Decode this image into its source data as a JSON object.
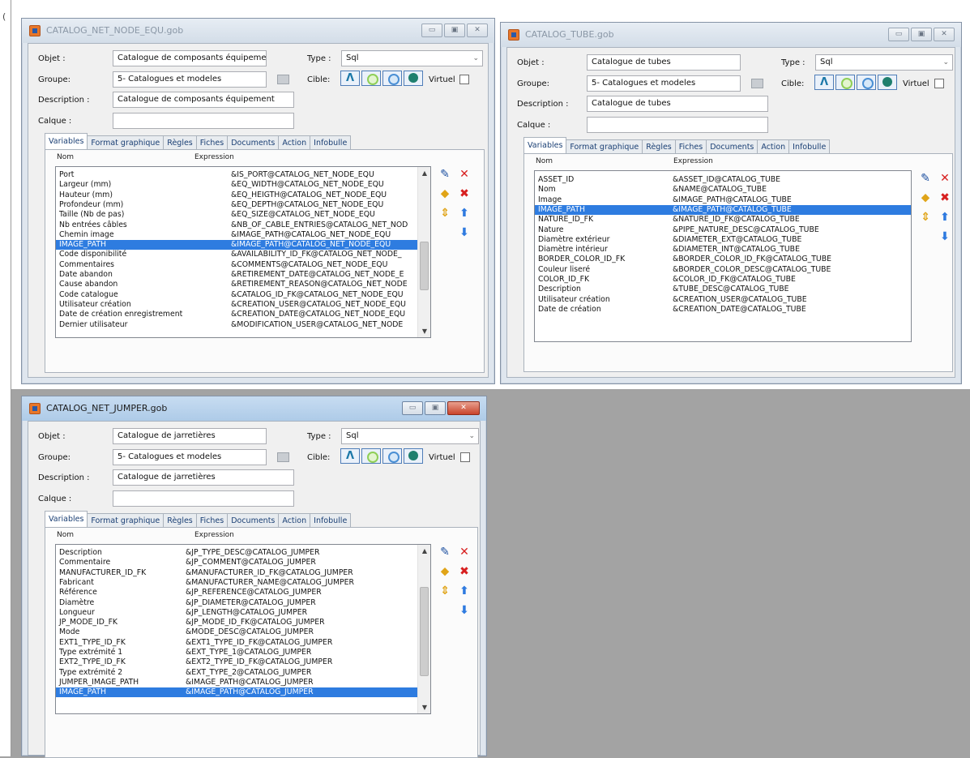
{
  "labels": {
    "objet": "Objet :",
    "groupe": "Groupe:",
    "description": "Description :",
    "calque": "Calque :",
    "type": "Type :",
    "cible": "Cible:",
    "virtuel": "Virtuel",
    "col_nom": "Nom",
    "col_expression": "Expression"
  },
  "tabs": [
    "Variables",
    "Format graphique",
    "Règles",
    "Fiches",
    "Documents",
    "Action",
    "Infobulle"
  ],
  "windows": {
    "equ": {
      "title": "CATALOG_NET_NODE_EQU.gob",
      "objet": "Catalogue de composants équipement",
      "type": "Sql",
      "groupe": "5- Catalogues et modeles",
      "description": "Catalogue de composants équipement",
      "calque": "",
      "variables": [
        {
          "nom": "Port",
          "expression": "&IS_PORT@CATALOG_NET_NODE_EQU"
        },
        {
          "nom": "Largeur (mm)",
          "expression": "&EQ_WIDTH@CATALOG_NET_NODE_EQU"
        },
        {
          "nom": "Hauteur (mm)",
          "expression": "&EQ_HEIGTH@CATALOG_NET_NODE_EQU"
        },
        {
          "nom": "Profondeur (mm)",
          "expression": "&EQ_DEPTH@CATALOG_NET_NODE_EQU"
        },
        {
          "nom": "Taille (Nb de pas)",
          "expression": "&EQ_SIZE@CATALOG_NET_NODE_EQU"
        },
        {
          "nom": "Nb entrées câbles",
          "expression": "&NB_OF_CABLE_ENTRIES@CATALOG_NET_NOD"
        },
        {
          "nom": "Chemin image",
          "expression": "&IMAGE_PATH@CATALOG_NET_NODE_EQU"
        },
        {
          "nom": "IMAGE_PATH",
          "expression": "&IMAGE_PATH@CATALOG_NET_NODE_EQU",
          "selected": true
        },
        {
          "nom": "Code disponibilité",
          "expression": "&AVAILABILITY_ID_FK@CATALOG_NET_NODE_"
        },
        {
          "nom": "Commentaires",
          "expression": "&COMMENTS@CATALOG_NET_NODE_EQU"
        },
        {
          "nom": "Date abandon",
          "expression": "&RETIREMENT_DATE@CATALOG_NET_NODE_E"
        },
        {
          "nom": "Cause abandon",
          "expression": "&RETIREMENT_REASON@CATALOG_NET_NODE"
        },
        {
          "nom": "Code catalogue",
          "expression": "&CATALOG_ID_FK@CATALOG_NET_NODE_EQU"
        },
        {
          "nom": "Utilisateur création",
          "expression": "&CREATION_USER@CATALOG_NET_NODE_EQU"
        },
        {
          "nom": "Date de création enregistrement",
          "expression": "&CREATION_DATE@CATALOG_NET_NODE_EQU"
        },
        {
          "nom": "Dernier utilisateur",
          "expression": "&MODIFICATION_USER@CATALOG_NET_NODE"
        }
      ]
    },
    "tube": {
      "title": "CATALOG_TUBE.gob",
      "objet": "Catalogue de tubes",
      "type": "Sql",
      "groupe": "5- Catalogues et modeles",
      "description": "Catalogue de tubes",
      "calque": "",
      "variables": [
        {
          "nom": "ASSET_ID",
          "expression": "&ASSET_ID@CATALOG_TUBE"
        },
        {
          "nom": "Nom",
          "expression": "&NAME@CATALOG_TUBE"
        },
        {
          "nom": "Image",
          "expression": "&IMAGE_PATH@CATALOG_TUBE"
        },
        {
          "nom": "IMAGE_PATH",
          "expression": "&IMAGE_PATH@CATALOG_TUBE",
          "selected": true
        },
        {
          "nom": "NATURE_ID_FK",
          "expression": "&NATURE_ID_FK@CATALOG_TUBE"
        },
        {
          "nom": "Nature",
          "expression": "&PIPE_NATURE_DESC@CATALOG_TUBE"
        },
        {
          "nom": "Diamètre extérieur",
          "expression": "&DIAMETER_EXT@CATALOG_TUBE"
        },
        {
          "nom": "Diamètre intérieur",
          "expression": "&DIAMETER_INT@CATALOG_TUBE"
        },
        {
          "nom": "BORDER_COLOR_ID_FK",
          "expression": "&BORDER_COLOR_ID_FK@CATALOG_TUBE"
        },
        {
          "nom": "Couleur liseré",
          "expression": "&BORDER_COLOR_DESC@CATALOG_TUBE"
        },
        {
          "nom": "COLOR_ID_FK",
          "expression": "&COLOR_ID_FK@CATALOG_TUBE"
        },
        {
          "nom": "Description",
          "expression": "&TUBE_DESC@CATALOG_TUBE"
        },
        {
          "nom": "Utilisateur création",
          "expression": "&CREATION_USER@CATALOG_TUBE"
        },
        {
          "nom": "Date de création",
          "expression": "&CREATION_DATE@CATALOG_TUBE"
        }
      ]
    },
    "jumper": {
      "title": "CATALOG_NET_JUMPER.gob",
      "objet": "Catalogue de jarretières",
      "type": "Sql",
      "groupe": "5- Catalogues et modeles",
      "description": "Catalogue de jarretières",
      "calque": "",
      "variables": [
        {
          "nom": "Description",
          "expression": "&JP_TYPE_DESC@CATALOG_JUMPER"
        },
        {
          "nom": "Commentaire",
          "expression": "&JP_COMMENT@CATALOG_JUMPER"
        },
        {
          "nom": "MANUFACTURER_ID_FK",
          "expression": "&MANUFACTURER_ID_FK@CATALOG_JUMPER"
        },
        {
          "nom": "Fabricant",
          "expression": "&MANUFACTURER_NAME@CATALOG_JUMPER"
        },
        {
          "nom": "Référence",
          "expression": "&JP_REFERENCE@CATALOG_JUMPER"
        },
        {
          "nom": "Diamètre",
          "expression": "&JP_DIAMETER@CATALOG_JUMPER"
        },
        {
          "nom": "Longueur",
          "expression": "&JP_LENGTH@CATALOG_JUMPER"
        },
        {
          "nom": "JP_MODE_ID_FK",
          "expression": "&JP_MODE_ID_FK@CATALOG_JUMPER"
        },
        {
          "nom": "Mode",
          "expression": "&MODE_DESC@CATALOG_JUMPER"
        },
        {
          "nom": "EXT1_TYPE_ID_FK",
          "expression": "&EXT1_TYPE_ID_FK@CATALOG_JUMPER"
        },
        {
          "nom": "Type extrémité 1",
          "expression": "&EXT_TYPE_1@CATALOG_JUMPER"
        },
        {
          "nom": "EXT2_TYPE_ID_FK",
          "expression": "&EXT2_TYPE_ID_FK@CATALOG_JUMPER"
        },
        {
          "nom": "Type extrémité 2",
          "expression": "&EXT_TYPE_2@CATALOG_JUMPER"
        },
        {
          "nom": "JUMPER_IMAGE_PATH",
          "expression": "&IMAGE_PATH@CATALOG_JUMPER"
        },
        {
          "nom": "IMAGE_PATH",
          "expression": "&IMAGE_PATH@CATALOG_JUMPER",
          "selected": true
        }
      ]
    }
  },
  "colors": {
    "selection": "#2e7ce0",
    "workspace": "#a3a3a3",
    "close_button": "#c9442c"
  },
  "icons": [
    "app-icon",
    "minimize-icon",
    "maximize-icon",
    "close-icon",
    "browse-icon",
    "cible-line-icon",
    "cible-green-circle-icon",
    "cible-blue-circle-icon",
    "cible-globe-icon",
    "edit-icon",
    "delete-icon",
    "insert-icon",
    "delete-all-icon",
    "move-icon",
    "move-up-icon",
    "move-down-icon"
  ]
}
